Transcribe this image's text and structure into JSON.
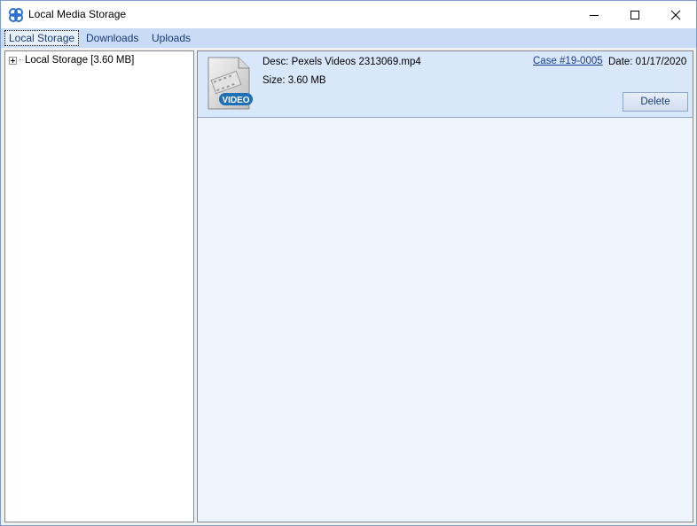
{
  "window": {
    "title": "Local Media Storage",
    "controls": {
      "minimize": "minimize-icon",
      "maximize": "maximize-icon",
      "close": "close-icon"
    }
  },
  "tabs": [
    {
      "label": "Local Storage",
      "active": true
    },
    {
      "label": "Downloads",
      "active": false
    },
    {
      "label": "Uploads",
      "active": false
    }
  ],
  "tree": {
    "root_label": "Local Storage [3.60 MB]",
    "expanded": false
  },
  "media_items": [
    {
      "thumbnail_icon": "video-file-icon",
      "thumbnail_badge": "VIDEO",
      "desc": "Desc: Pexels Videos 2313069.mp4",
      "size": "Size: 3.60 MB",
      "case_link": "Case #19-0005",
      "date": "Date: 01/17/2020",
      "delete_label": "Delete"
    }
  ],
  "colors": {
    "accent_blue": "#1a3c8c",
    "tab_bar": "#c8dcf5",
    "card_background": "#d9e7fa",
    "content_background": "#eef4fc",
    "video_badge": "#1d6fb8"
  }
}
